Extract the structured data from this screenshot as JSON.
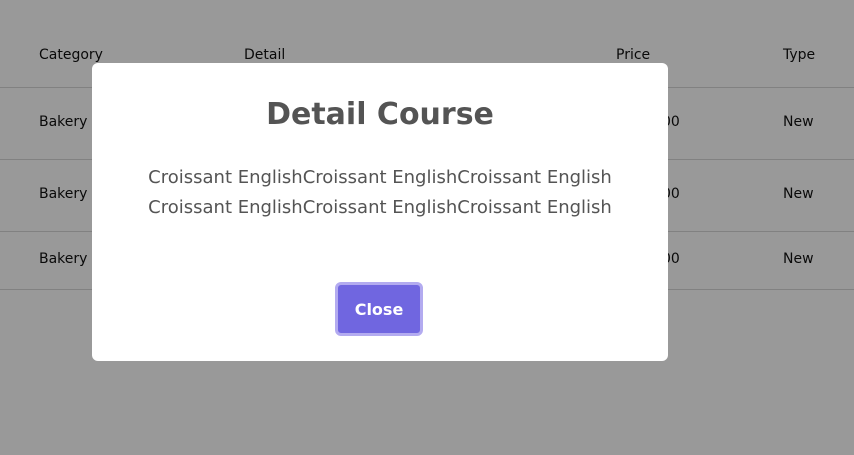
{
  "table": {
    "headers": {
      "category": "Category",
      "detail": "Detail",
      "price": "Price",
      "type": "Type"
    },
    "rows": [
      {
        "category": "Bakery",
        "price_partial": "00",
        "type": "New"
      },
      {
        "category": "Bakery",
        "price_partial": "00",
        "type": "New"
      },
      {
        "category": "Bakery",
        "price_partial": "00",
        "type": "New"
      }
    ]
  },
  "modal": {
    "title": "Detail Course",
    "text": "Croissant EnglishCroissant EnglishCroissant EnglishCroissant EnglishCroissant EnglishCroissant English",
    "close_label": "Close"
  },
  "colors": {
    "overlay": "#999999",
    "button": "#7066e0",
    "button_border": "#b3abf0",
    "title_text": "#545454"
  }
}
